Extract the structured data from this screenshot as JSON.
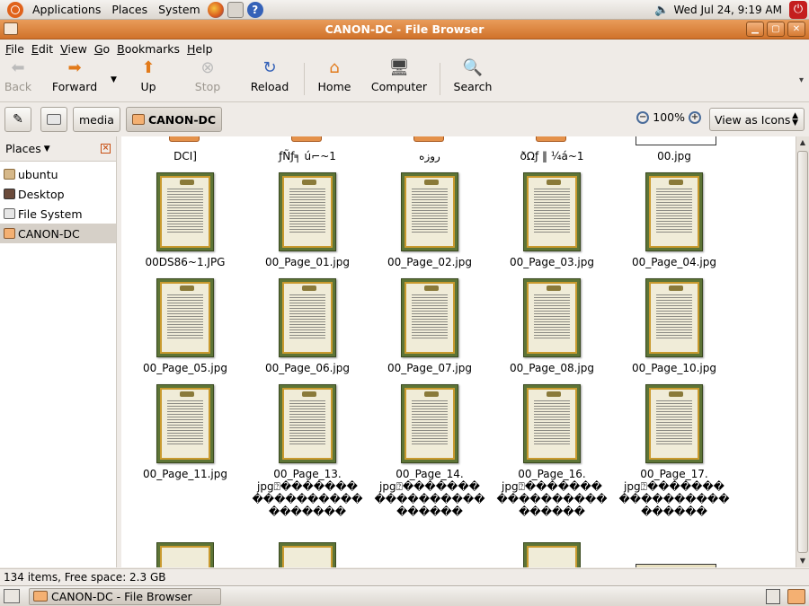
{
  "top_panel": {
    "menus": [
      "Applications",
      "Places",
      "System"
    ],
    "clock": "Wed Jul 24,  9:19 AM"
  },
  "window": {
    "title": "CANON-DC - File Browser"
  },
  "menubar": [
    {
      "label": "File",
      "mnemonic": "F",
      "rest": "ile"
    },
    {
      "label": "Edit",
      "mnemonic": "E",
      "rest": "dit"
    },
    {
      "label": "View",
      "mnemonic": "V",
      "rest": "iew"
    },
    {
      "label": "Go",
      "mnemonic": "G",
      "rest": "o"
    },
    {
      "label": "Bookmarks",
      "mnemonic": "B",
      "rest": "ookmarks"
    },
    {
      "label": "Help",
      "mnemonic": "H",
      "rest": "elp"
    }
  ],
  "toolbar": {
    "back": "Back",
    "forward": "Forward",
    "up": "Up",
    "stop": "Stop",
    "reload": "Reload",
    "home": "Home",
    "computer": "Computer",
    "search": "Search"
  },
  "location": {
    "crumbs": [
      "media",
      "CANON-DC"
    ],
    "zoom": "100%",
    "view_mode": "View as Icons"
  },
  "sidebar": {
    "header": "Places",
    "items": [
      "ubuntu",
      "Desktop",
      "File System",
      "CANON-DC"
    ]
  },
  "files": {
    "row0": [
      "DCI]",
      "ƒÑƒ╕ ú⌐~1",
      "روزه",
      "ðΩƒ ‖ ¼á~1",
      "00.jpg"
    ],
    "row1": [
      "00DS86~1.JPG",
      "00_Page_01.jpg",
      "00_Page_02.jpg",
      "00_Page_03.jpg",
      "00_Page_04.jpg"
    ],
    "row2": [
      "00_Page_05.jpg",
      "00_Page_06.jpg",
      "00_Page_07.jpg",
      "00_Page_08.jpg",
      "00_Page_10.jpg"
    ],
    "row3": [
      "00_Page_11.jpg",
      "00_Page_13.\njpg⍰�������\n����������\n�������",
      "00_Page_14.\njpg⍰�������\n����������\n������",
      "00_Page_16.\njpg⍰�������\n����������\n������",
      "00_Page_17.\njpg⍰�������\n����������\n������"
    ]
  },
  "status": "134 items, Free space: 2.3 GB",
  "taskbar": {
    "window_button": "CANON-DC - File Browser"
  }
}
